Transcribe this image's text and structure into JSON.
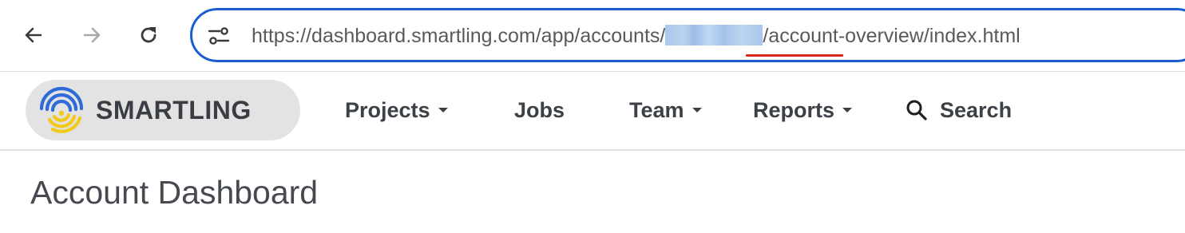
{
  "browser": {
    "url_prefix": "https://dashboard.smartling.com/app/accounts/",
    "url_suffix": "/account-overview/index.html",
    "url_redacted": true,
    "accent_color": "#1a5fd0",
    "highlight_color": "#d8281e",
    "icons": [
      "back-arrow-icon",
      "forward-arrow-icon",
      "reload-icon",
      "site-info-icon"
    ]
  },
  "nav": {
    "logo_text": "SMARTLING",
    "items": [
      {
        "label": "Projects",
        "dropdown": true
      },
      {
        "label": "Jobs",
        "dropdown": false
      },
      {
        "label": "Team",
        "dropdown": true
      },
      {
        "label": "Reports",
        "dropdown": true
      },
      {
        "label": "Search",
        "icon": "search-icon"
      }
    ],
    "logo_colors": [
      "#2e6bd6",
      "#f2c81a"
    ]
  },
  "page": {
    "title": "Account Dashboard"
  }
}
